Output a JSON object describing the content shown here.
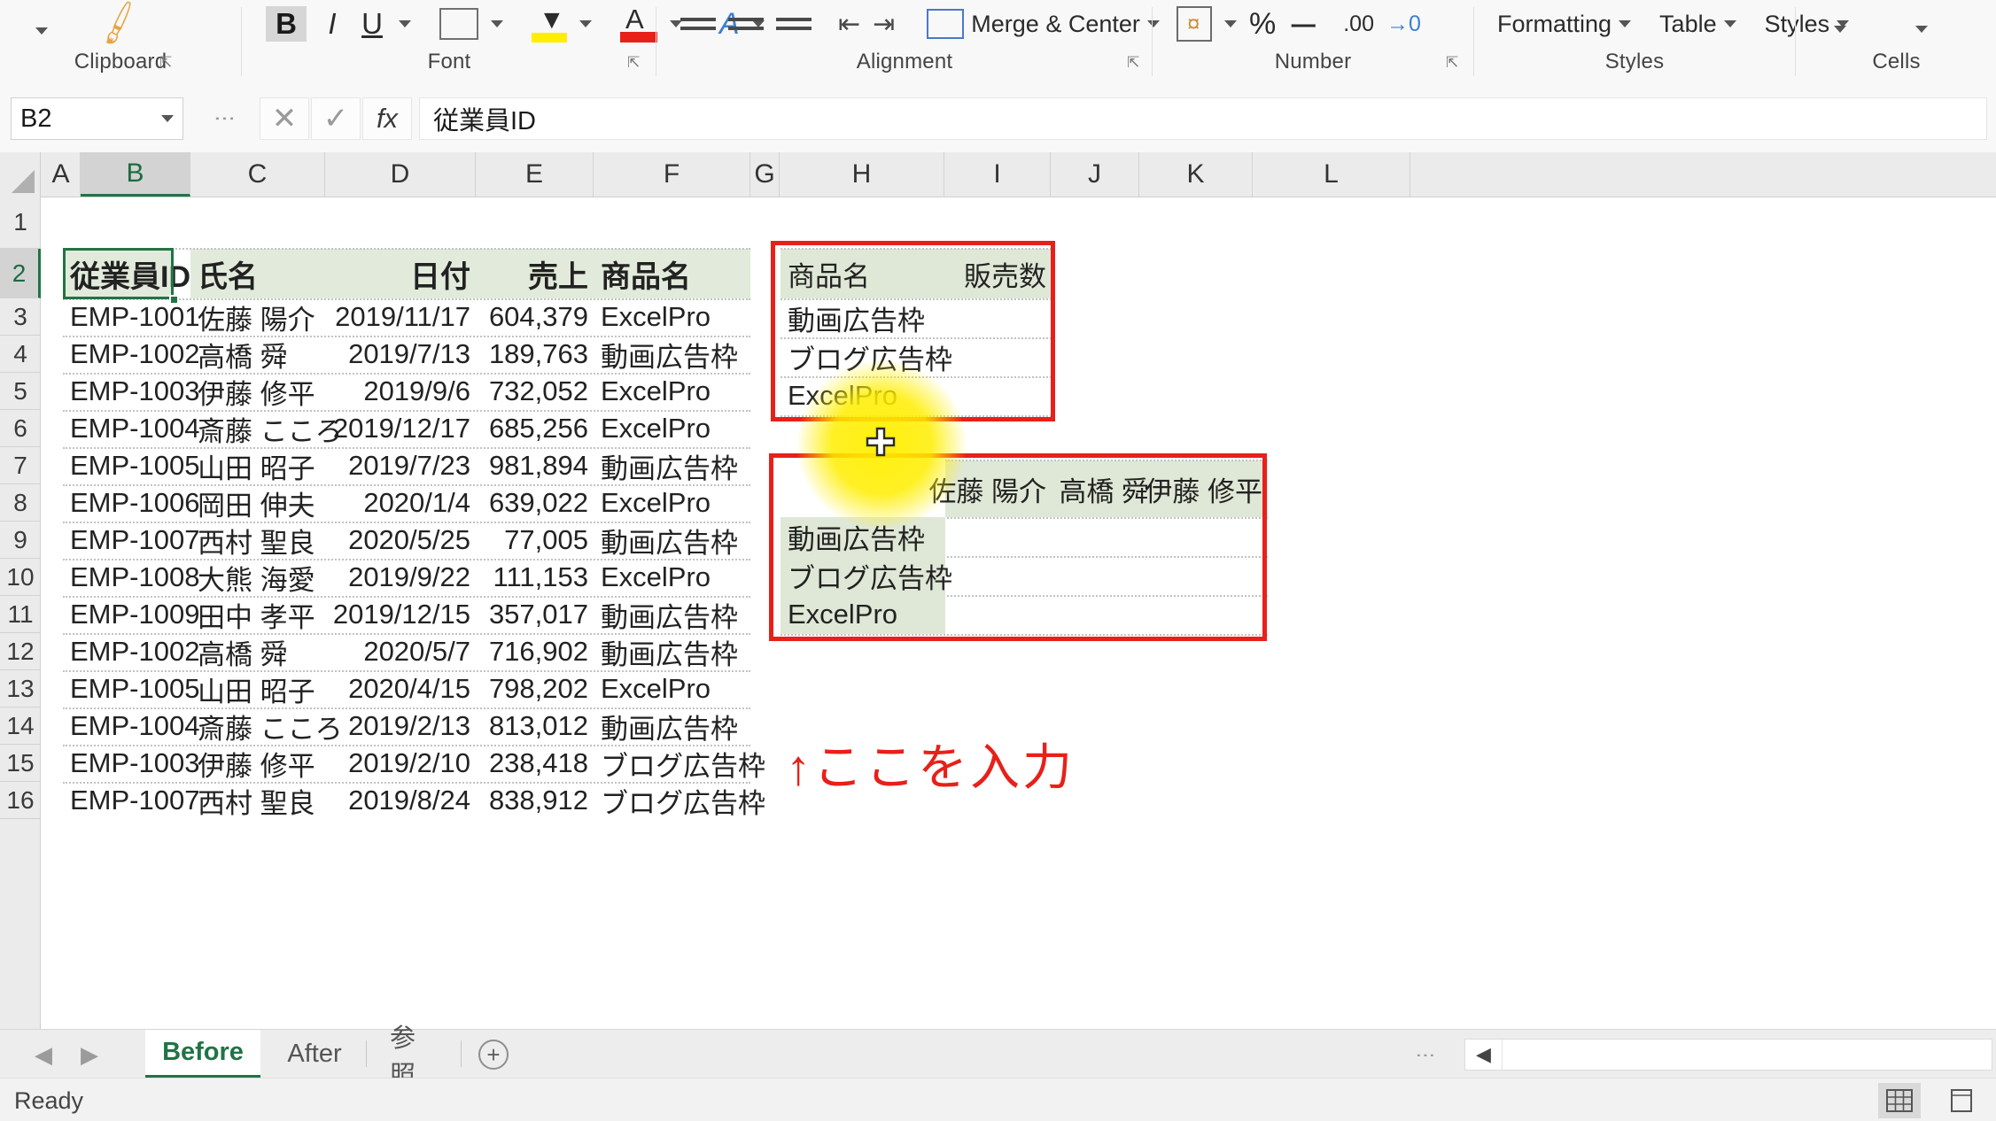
{
  "ribbon": {
    "groups": [
      {
        "name": "Clipboard",
        "label": "Clipboard"
      },
      {
        "name": "Font",
        "label": "Font"
      },
      {
        "name": "Alignment",
        "label": "Alignment"
      },
      {
        "name": "Number",
        "label": "Number"
      },
      {
        "name": "Styles",
        "label": "Styles"
      },
      {
        "name": "Cells",
        "label": "Cells"
      }
    ],
    "font_items": [
      "B",
      "I",
      "U"
    ],
    "alignment_merge_label": "Merge & Center",
    "number_items": [
      "%",
      "ー",
      ".00",
      "→0"
    ],
    "styles_items": [
      "Formatting",
      "Table",
      "Styles"
    ]
  },
  "formula_bar": {
    "name_box": "B2",
    "cancel_icon": "✕",
    "confirm_icon": "✓",
    "fx_icon": "fx",
    "formula_value": "従業員ID",
    "formula_placeholder": ""
  },
  "grid": {
    "columns": [
      "A",
      "B",
      "C",
      "D",
      "E",
      "F",
      "G",
      "H",
      "I",
      "J",
      "K",
      "L"
    ],
    "selected_column": "B",
    "rows": [
      "1",
      "2",
      "3",
      "4",
      "5",
      "6",
      "7",
      "8",
      "9",
      "10",
      "11",
      "12",
      "13",
      "14",
      "15",
      "16"
    ],
    "selected_row": "2",
    "active_cell": "B2"
  },
  "main_table": {
    "headers": {
      "employee_id": "従業員ID",
      "name": "氏名",
      "date": "日付",
      "sales": "売上",
      "product": "商品名"
    },
    "rows": [
      {
        "id": "EMP-1001",
        "name": "佐藤 陽介",
        "date": "2019/11/17",
        "sales": "604,379",
        "product": "ExcelPro"
      },
      {
        "id": "EMP-1002",
        "name": "高橋 舜",
        "date": "2019/7/13",
        "sales": "189,763",
        "product": "動画広告枠"
      },
      {
        "id": "EMP-1003",
        "name": "伊藤 修平",
        "date": "2019/9/6",
        "sales": "732,052",
        "product": "ExcelPro"
      },
      {
        "id": "EMP-1004",
        "name": "斎藤 こころ",
        "date": "2019/12/17",
        "sales": "685,256",
        "product": "ExcelPro"
      },
      {
        "id": "EMP-1005",
        "name": "山田 昭子",
        "date": "2019/7/23",
        "sales": "981,894",
        "product": "動画広告枠"
      },
      {
        "id": "EMP-1006",
        "name": "岡田 伸夫",
        "date": "2020/1/4",
        "sales": "639,022",
        "product": "ExcelPro"
      },
      {
        "id": "EMP-1007",
        "name": "西村 聖良",
        "date": "2020/5/25",
        "sales": "77,005",
        "product": "動画広告枠"
      },
      {
        "id": "EMP-1008",
        "name": "大熊 海愛",
        "date": "2019/9/22",
        "sales": "111,153",
        "product": "ExcelPro"
      },
      {
        "id": "EMP-1009",
        "name": "田中 孝平",
        "date": "2019/12/15",
        "sales": "357,017",
        "product": "動画広告枠"
      },
      {
        "id": "EMP-1002",
        "name": "高橋 舜",
        "date": "2020/5/7",
        "sales": "716,902",
        "product": "動画広告枠"
      },
      {
        "id": "EMP-1005",
        "name": "山田 昭子",
        "date": "2020/4/15",
        "sales": "798,202",
        "product": "ExcelPro"
      },
      {
        "id": "EMP-1004",
        "name": "斎藤 こころ",
        "date": "2019/2/13",
        "sales": "813,012",
        "product": "動画広告枠"
      },
      {
        "id": "EMP-1003",
        "name": "伊藤 修平",
        "date": "2019/2/10",
        "sales": "238,418",
        "product": "ブログ広告枠"
      },
      {
        "id": "EMP-1007",
        "name": "西村 聖良",
        "date": "2019/8/24",
        "sales": "838,912",
        "product": "ブログ広告枠"
      }
    ]
  },
  "summary_table_1": {
    "headers": [
      "商品名",
      "販売数"
    ],
    "rows": [
      {
        "product": "動画広告枠",
        "count": ""
      },
      {
        "product": "ブログ広告枠",
        "count": ""
      },
      {
        "product": "ExcelPro",
        "count": ""
      }
    ]
  },
  "summary_table_2": {
    "corner": "",
    "col_headers": [
      "佐藤 陽介",
      "高橋 舜",
      "伊藤 修平"
    ],
    "row_headers": [
      "動画広告枠",
      "ブログ広告枠",
      "ExcelPro"
    ],
    "values": [
      [
        "",
        "",
        ""
      ],
      [
        "",
        "",
        ""
      ],
      [
        "",
        "",
        ""
      ]
    ]
  },
  "annotation": {
    "text": "↑ここを入力",
    "color": "#e8201a"
  },
  "sheet_tabs": {
    "tabs": [
      "Before",
      "After",
      "参照"
    ],
    "active": "Before",
    "add_label": "+",
    "prev_icon": "◀",
    "next_icon": "▶"
  },
  "status_bar": {
    "status": "Ready",
    "normal_view_icon": "grid-view-icon",
    "page_layout_icon": "page-layout-icon"
  },
  "colors": {
    "accent_green": "#217346",
    "header_fill": "#e2ebdb",
    "annotation_red": "#e8201a",
    "cursor_highlight": "#ffee00"
  }
}
